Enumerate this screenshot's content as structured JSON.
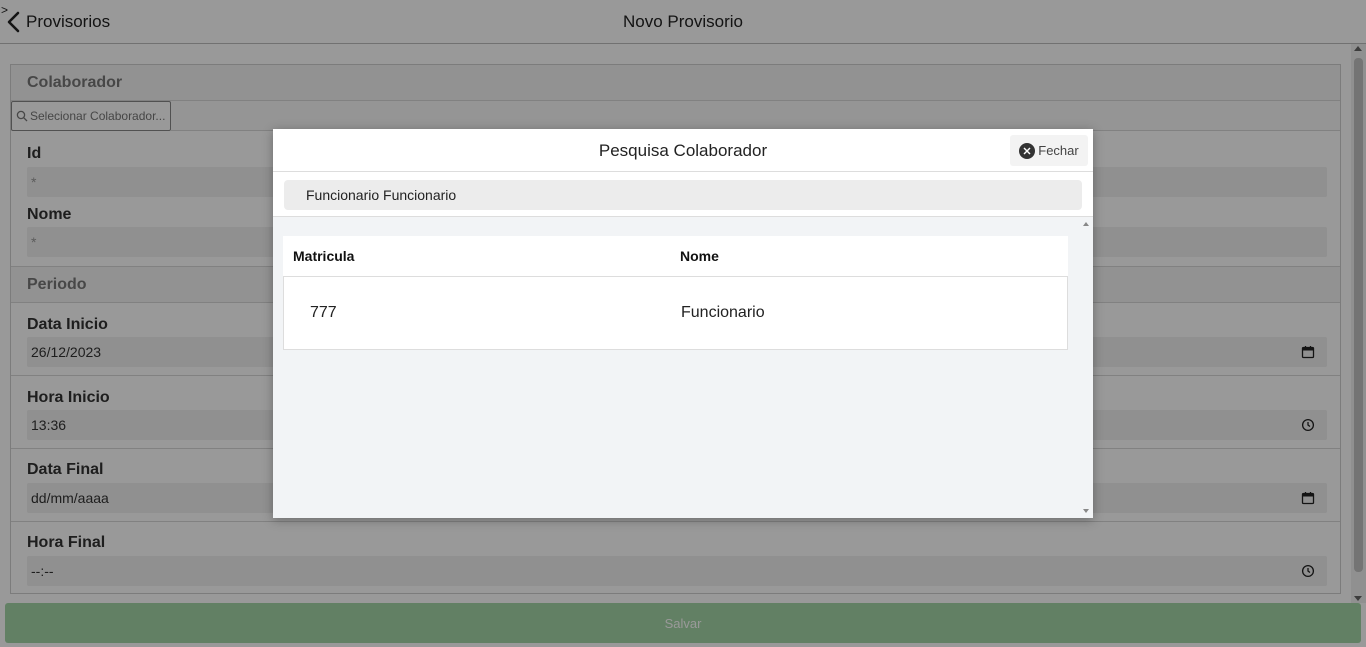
{
  "header": {
    "back_label": "Provisorios",
    "title": "Novo Provisorio"
  },
  "form": {
    "colaborador_section": "Colaborador",
    "search_placeholder": "Selecionar Colaborador...",
    "id_label": "Id",
    "id_value": "*",
    "nome_label": "Nome",
    "nome_value": "*",
    "periodo_section": "Periodo",
    "data_inicio_label": "Data Inicio",
    "data_inicio_value": "26/12/2023",
    "hora_inicio_label": "Hora Inicio",
    "hora_inicio_value": "13:36",
    "data_final_label": "Data Final",
    "data_final_value": "dd/mm/aaaa",
    "hora_final_label": "Hora Final",
    "hora_final_value": "--:--"
  },
  "save_label": "Salvar",
  "modal": {
    "title": "Pesquisa Colaborador",
    "close_label": "Fechar",
    "search_value": "Funcionario Funcionario",
    "columns": [
      "Matricula",
      "Nome"
    ],
    "rows": [
      {
        "matricula": "777",
        "nome": "Funcionario"
      }
    ]
  },
  "colors": {
    "overlay": "#000000",
    "save_bg": "#a4d6a7"
  },
  "icons": {
    "back": "chevron-left-icon",
    "search": "search-icon",
    "calendar": "calendar-icon",
    "clock": "clock-icon",
    "close": "close-circle-icon"
  }
}
